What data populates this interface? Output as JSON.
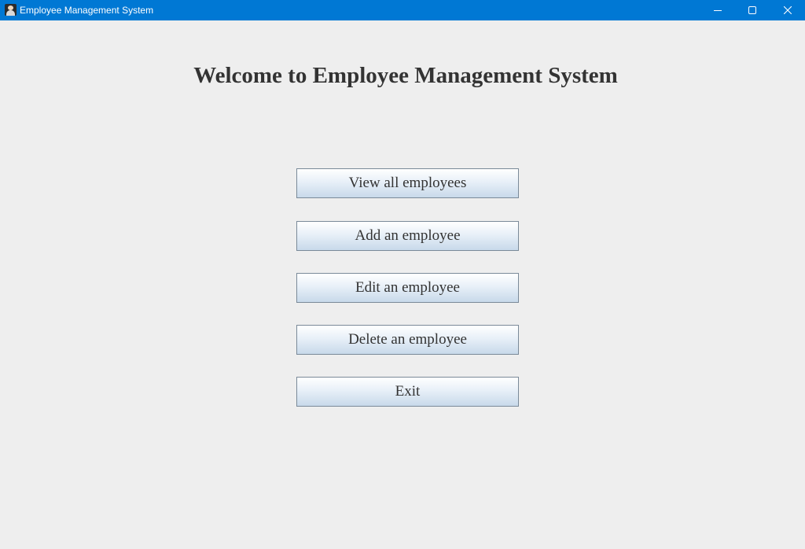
{
  "window": {
    "title": "Employee Management System",
    "icon": "employee-person-icon",
    "controls": [
      {
        "name": "minimize",
        "icon": "minimize-icon"
      },
      {
        "name": "maximize",
        "icon": "maximize-icon"
      },
      {
        "name": "close",
        "icon": "close-icon"
      }
    ],
    "titlebar_color": "#0078d4"
  },
  "main": {
    "heading": "Welcome to Employee Management System",
    "buttons": [
      {
        "label": "View all employees"
      },
      {
        "label": "Add an employee"
      },
      {
        "label": "Edit an employee"
      },
      {
        "label": "Delete an employee"
      },
      {
        "label": "Exit"
      }
    ]
  }
}
